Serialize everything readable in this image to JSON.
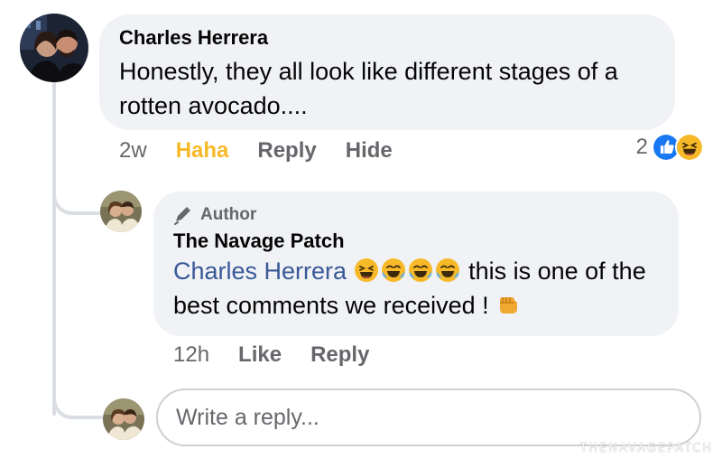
{
  "comment": {
    "author": "Charles Herrera",
    "text": "Honestly, they all look like different stages of a rotten avocado....",
    "time": "2w",
    "actions": {
      "haha": "Haha",
      "reply": "Reply",
      "hide": "Hide"
    },
    "reaction_count": "2",
    "reaction_icons": [
      "like-icon",
      "haha-icon"
    ]
  },
  "reply": {
    "badge": "Author",
    "author": "The Navage Patch",
    "mention": "Charles Herrera",
    "text": "this is one of the best comments we received !",
    "emojis": [
      "laughing-emoji",
      "tears-of-joy-emoji",
      "tears-of-joy-emoji",
      "tears-of-joy-emoji",
      "oncoming-fist-emoji"
    ],
    "time": "12h",
    "actions": {
      "like": "Like",
      "reply": "Reply"
    }
  },
  "reply_box": {
    "placeholder": "Write a reply..."
  },
  "watermark": "THENAVAGEPATCH",
  "colors": {
    "bubble": "#f0f2f5",
    "secondary_text": "#65676b",
    "haha_active": "#f7b928",
    "mention": "#385898",
    "like_blue": "#1877f2"
  }
}
